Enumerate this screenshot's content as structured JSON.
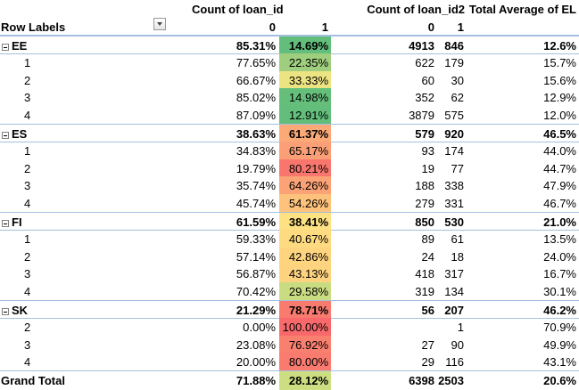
{
  "header": {
    "count_loan_id": "Count of loan_id",
    "count_loan_id2": "Count of loan_id2",
    "total_avg_el": "Total Average of EL",
    "row_labels": "Row Labels",
    "col0": "0",
    "col1": "1",
    "col0b": "0",
    "col1b": "1"
  },
  "rows": [
    {
      "kind": "group",
      "label": "EE",
      "p0": "85.31%",
      "p1": "14.69%",
      "n0": "4913",
      "n1": "846",
      "el": "12.6%",
      "color": "#63be7b"
    },
    {
      "kind": "child",
      "label": "1",
      "p0": "77.65%",
      "p1": "22.35%",
      "n0": "622",
      "n1": "179",
      "el": "15.7%",
      "color": "#9fcf7e"
    },
    {
      "kind": "child",
      "label": "2",
      "p0": "66.67%",
      "p1": "33.33%",
      "n0": "60",
      "n1": "30",
      "el": "15.6%",
      "color": "#ece382"
    },
    {
      "kind": "child",
      "label": "3",
      "p0": "85.02%",
      "p1": "14.98%",
      "n0": "352",
      "n1": "62",
      "el": "12.9%",
      "color": "#65bf7b"
    },
    {
      "kind": "child",
      "label": "4",
      "p0": "87.09%",
      "p1": "12.91%",
      "n0": "3879",
      "n1": "575",
      "el": "12.0%",
      "color": "#63be7b"
    },
    {
      "kind": "group",
      "label": "ES",
      "p0": "38.63%",
      "p1": "61.37%",
      "n0": "579",
      "n1": "920",
      "el": "46.5%",
      "color": "#fbaa77"
    },
    {
      "kind": "child",
      "label": "1",
      "p0": "34.83%",
      "p1": "65.17%",
      "n0": "93",
      "n1": "174",
      "el": "44.0%",
      "color": "#fba076"
    },
    {
      "kind": "child",
      "label": "2",
      "p0": "19.79%",
      "p1": "80.21%",
      "n0": "19",
      "n1": "77",
      "el": "44.7%",
      "color": "#f8766d"
    },
    {
      "kind": "child",
      "label": "3",
      "p0": "35.74%",
      "p1": "64.26%",
      "n0": "188",
      "n1": "338",
      "el": "47.9%",
      "color": "#fba276"
    },
    {
      "kind": "child",
      "label": "4",
      "p0": "45.74%",
      "p1": "54.26%",
      "n0": "279",
      "n1": "331",
      "el": "46.7%",
      "color": "#fdc37c"
    },
    {
      "kind": "group",
      "label": "FI",
      "p0": "61.59%",
      "p1": "38.41%",
      "n0": "850",
      "n1": "530",
      "el": "21.0%",
      "color": "#fee182"
    },
    {
      "kind": "child",
      "label": "1",
      "p0": "59.33%",
      "p1": "40.67%",
      "n0": "89",
      "n1": "61",
      "el": "13.5%",
      "color": "#feda80"
    },
    {
      "kind": "child",
      "label": "2",
      "p0": "57.14%",
      "p1": "42.86%",
      "n0": "24",
      "n1": "18",
      "el": "24.0%",
      "color": "#fed47f"
    },
    {
      "kind": "child",
      "label": "3",
      "p0": "56.87%",
      "p1": "43.13%",
      "n0": "418",
      "n1": "317",
      "el": "16.7%",
      "color": "#fed37f"
    },
    {
      "kind": "child",
      "label": "4",
      "p0": "70.42%",
      "p1": "29.58%",
      "n0": "319",
      "n1": "134",
      "el": "30.1%",
      "color": "#cadc81"
    },
    {
      "kind": "group",
      "label": "SK",
      "p0": "21.29%",
      "p1": "78.71%",
      "n0": "56",
      "n1": "207",
      "el": "46.2%",
      "color": "#f97a6e"
    },
    {
      "kind": "child",
      "label": "2",
      "p0": "0.00%",
      "p1": "100.00%",
      "n0": "",
      "n1": "1",
      "el": "70.9%",
      "color": "#f8696b"
    },
    {
      "kind": "child",
      "label": "3",
      "p0": "23.08%",
      "p1": "76.92%",
      "n0": "27",
      "n1": "90",
      "el": "49.9%",
      "color": "#f97f6f"
    },
    {
      "kind": "child",
      "label": "4",
      "p0": "20.00%",
      "p1": "80.00%",
      "n0": "29",
      "n1": "116",
      "el": "43.1%",
      "color": "#f97a6e"
    },
    {
      "kind": "total",
      "label": "Grand Total",
      "p0": "71.88%",
      "p1": "28.12%",
      "n0": "6398",
      "n1": "2503",
      "el": "20.6%",
      "color": "#cdde82"
    }
  ],
  "colors": {
    "border": "#a6bfe0",
    "scale_green": "#63be7b",
    "scale_yellow": "#ffeb84",
    "scale_red": "#f8696b"
  }
}
